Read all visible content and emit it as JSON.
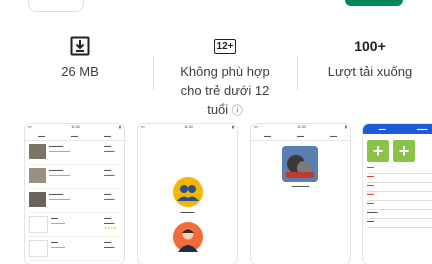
{
  "stats": [
    {
      "icon": "download-icon",
      "text": "26 MB"
    },
    {
      "icon": "age-rating-icon",
      "rating_label": "12+",
      "text_lines": [
        "Không phù hợp",
        "cho trẻ dưới 12",
        "tuổi"
      ],
      "info_icon": "info-icon"
    },
    {
      "value": "100+",
      "text": "Lượt tải xuống"
    }
  ],
  "screenshots": [
    {
      "label": "screenshot-1"
    },
    {
      "label": "screenshot-2"
    },
    {
      "label": "screenshot-3"
    },
    {
      "label": "screenshot-4"
    }
  ],
  "colors": {
    "accent": "#01875f",
    "blue_header": "#1e5bd8",
    "green_button": "#8bc34a"
  }
}
